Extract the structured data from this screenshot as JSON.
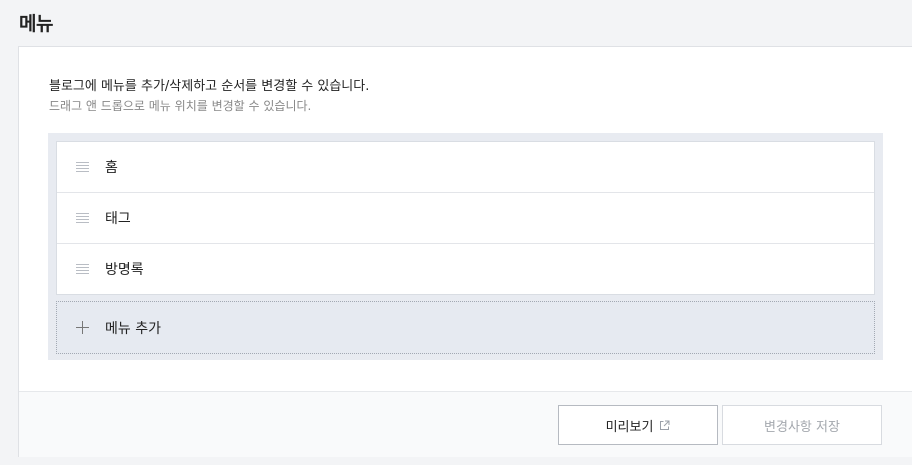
{
  "page": {
    "title": "메뉴"
  },
  "description": {
    "main": "블로그에 메뉴를 추가/삭제하고 순서를 변경할 수 있습니다.",
    "sub": "드래그 앤 드롭으로 메뉴 위치를 변경할 수 있습니다."
  },
  "menu": {
    "items": [
      {
        "label": "홈",
        "icon": "drag-handle-icon"
      },
      {
        "label": "태그",
        "icon": "drag-handle-icon"
      },
      {
        "label": "방명록",
        "icon": "drag-handle-icon"
      }
    ],
    "add_label": "메뉴 추가",
    "add_icon": "plus-icon"
  },
  "footer": {
    "preview_label": "미리보기",
    "preview_icon": "external-link-icon",
    "save_label": "변경사항 저장"
  },
  "colors": {
    "menu_box_bg": "#e8ebf1",
    "save_disabled_text": "#a4a8ae"
  }
}
